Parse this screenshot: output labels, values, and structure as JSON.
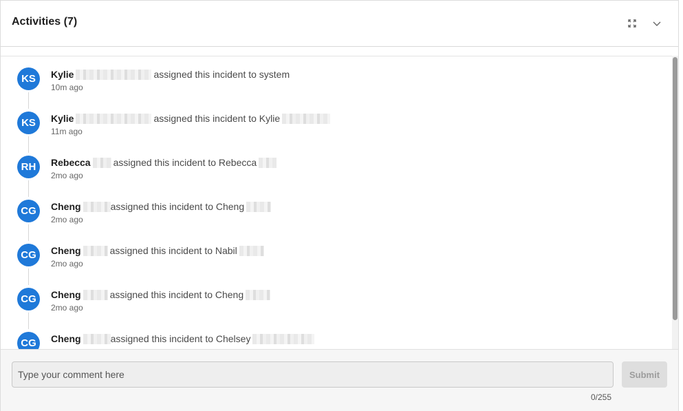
{
  "header": {
    "title": "Activities (7)",
    "expand_icon": "expand-icon",
    "collapse_icon": "chevron-down-icon"
  },
  "activities": [
    {
      "initials": "KS",
      "actor": "Kylie",
      "action": "assigned this incident to system",
      "time": "10m ago"
    },
    {
      "initials": "KS",
      "actor": "Kylie",
      "action": "assigned this incident to Kylie",
      "time": "11m ago"
    },
    {
      "initials": "RH",
      "actor": "Rebecca",
      "action": "assigned this incident to Rebecca",
      "time": "2mo ago"
    },
    {
      "initials": "CG",
      "actor": "Cheng",
      "action": "assigned this incident to Cheng",
      "time": "2mo ago"
    },
    {
      "initials": "CG",
      "actor": "Cheng",
      "action": "assigned this incident to Nabil",
      "time": "2mo ago"
    },
    {
      "initials": "CG",
      "actor": "Cheng",
      "action": "assigned this incident to Cheng",
      "time": "2mo ago"
    },
    {
      "initials": "CG",
      "actor": "Cheng",
      "action": "assigned this incident to Chelsey",
      "time": ""
    }
  ],
  "comment": {
    "placeholder": "Type your comment here",
    "value": "",
    "counter": "0/255",
    "submit_label": "Submit"
  },
  "colors": {
    "avatar": "#1f79d9",
    "submit_disabled_bg": "#dedede"
  }
}
